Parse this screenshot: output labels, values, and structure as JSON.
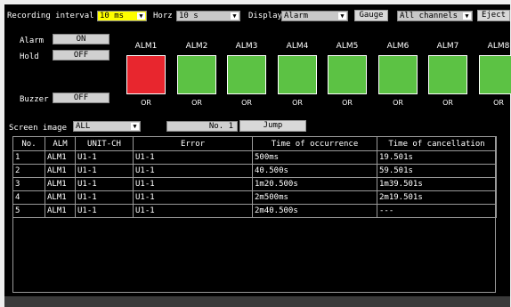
{
  "toolbar": {
    "recording_interval_label": "Recording interval",
    "recording_interval_value": "10 ms",
    "horz_label": "Horz",
    "horz_value": "10 s",
    "display_label": "Display",
    "display_value": "Alarm",
    "gauge_button": "Gauge",
    "channels_value": "All channels",
    "eject_button": "Eject"
  },
  "settings": {
    "alarm_label": "Alarm",
    "alarm_value": "ON",
    "hold_label": "Hold",
    "hold_value": "OFF",
    "buzzer_label": "Buzzer",
    "buzzer_value": "OFF"
  },
  "alarms": [
    {
      "label": "ALM1",
      "status": "OR",
      "color": "#e8262e"
    },
    {
      "label": "ALM2",
      "status": "OR",
      "color": "#5cc244"
    },
    {
      "label": "ALM3",
      "status": "OR",
      "color": "#5cc244"
    },
    {
      "label": "ALM4",
      "status": "OR",
      "color": "#5cc244"
    },
    {
      "label": "ALM5",
      "status": "OR",
      "color": "#5cc244"
    },
    {
      "label": "ALM6",
      "status": "OR",
      "color": "#5cc244"
    },
    {
      "label": "ALM7",
      "status": "OR",
      "color": "#5cc244"
    },
    {
      "label": "ALM8",
      "status": "OR",
      "color": "#5cc244"
    }
  ],
  "screen_image": {
    "label": "Screen image",
    "value": "ALL",
    "number_label": "No.",
    "number_value": "1",
    "jump_button": "Jump"
  },
  "table": {
    "headers": [
      "No.",
      "ALM",
      "UNIT-CH",
      "Error",
      "Time of occurrence",
      "Time of cancellation"
    ],
    "rows": [
      [
        "1",
        "ALM1",
        "U1-1",
        "U1-1",
        "500ms",
        "19.501s"
      ],
      [
        "2",
        "ALM1",
        "U1-1",
        "U1-1",
        "40.500s",
        "59.501s"
      ],
      [
        "3",
        "ALM1",
        "U1-1",
        "U1-1",
        "1m20.500s",
        "1m39.501s"
      ],
      [
        "4",
        "ALM1",
        "U1-1",
        "U1-1",
        "2m500ms",
        "2m19.501s"
      ],
      [
        "5",
        "ALM1",
        "U1-1",
        "U1-1",
        "2m40.500s",
        "---"
      ]
    ]
  }
}
